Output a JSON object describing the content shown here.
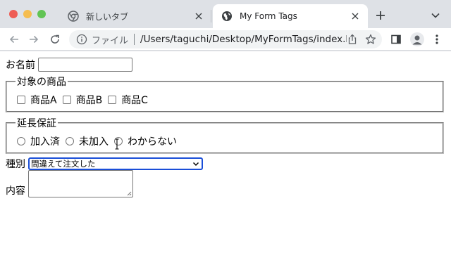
{
  "browser": {
    "tabs": [
      {
        "title": "新しいタブ",
        "active": false,
        "icon": "chrome-icon"
      },
      {
        "title": "My Form Tags",
        "active": true,
        "icon": "globe-icon"
      }
    ],
    "omnibox": {
      "security_label": "ファイル",
      "url": "/Users/taguchi/Desktop/MyFormTags/index.html"
    }
  },
  "form": {
    "name_label": "お名前",
    "name_value": "",
    "products": {
      "legend": "対象の商品",
      "options": [
        "商品A",
        "商品B",
        "商品C"
      ]
    },
    "warranty": {
      "legend": "延長保証",
      "options": [
        "加入済",
        "未加入",
        "わからない"
      ]
    },
    "kind_label": "種別",
    "kind_selected": "間違えて注文した",
    "content_label": "内容",
    "content_value": ""
  },
  "colors": {
    "tabstrip": "#dee1e6",
    "select_focus": "#1a4ed8",
    "close": "#ee5d55",
    "minimize": "#f5bd4f",
    "zoom": "#61c454"
  }
}
